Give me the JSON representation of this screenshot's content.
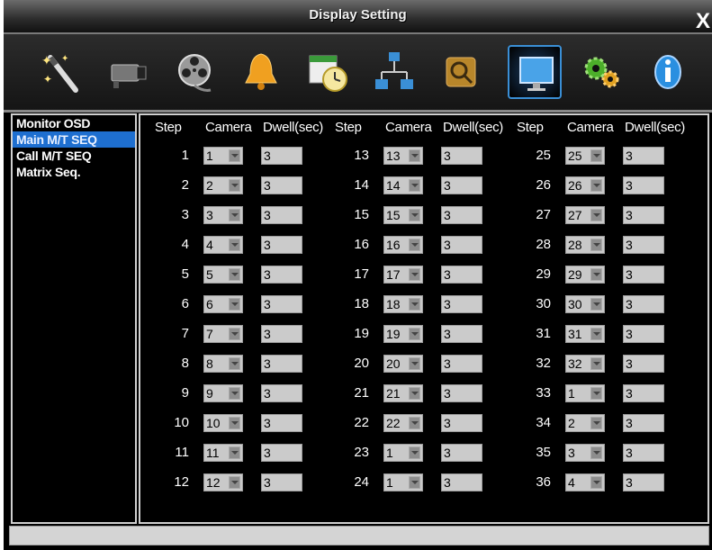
{
  "window": {
    "title": "Display Setting",
    "close_glyph": "X"
  },
  "toolbar": {
    "icons": [
      {
        "name": "wizard-wand-icon"
      },
      {
        "name": "camera-icon"
      },
      {
        "name": "film-reel-icon"
      },
      {
        "name": "alarm-bell-icon"
      },
      {
        "name": "schedule-clock-icon"
      },
      {
        "name": "network-icon"
      },
      {
        "name": "search-tools-icon"
      },
      {
        "name": "display-monitor-icon",
        "selected": true
      },
      {
        "name": "gears-icon"
      },
      {
        "name": "info-icon"
      }
    ]
  },
  "sidebar": {
    "items": [
      {
        "label": "Monitor OSD",
        "selected": false
      },
      {
        "label": "Main M/T SEQ",
        "selected": true
      },
      {
        "label": "Call M/T SEQ",
        "selected": false
      },
      {
        "label": "Matrix Seq.",
        "selected": false
      }
    ]
  },
  "table": {
    "headers": {
      "step": "Step",
      "camera": "Camera",
      "dwell": "Dwell(sec)"
    },
    "columns": [
      {
        "rows": [
          {
            "step": "1",
            "camera": "1",
            "dwell": "3"
          },
          {
            "step": "2",
            "camera": "2",
            "dwell": "3"
          },
          {
            "step": "3",
            "camera": "3",
            "dwell": "3"
          },
          {
            "step": "4",
            "camera": "4",
            "dwell": "3"
          },
          {
            "step": "5",
            "camera": "5",
            "dwell": "3"
          },
          {
            "step": "6",
            "camera": "6",
            "dwell": "3"
          },
          {
            "step": "7",
            "camera": "7",
            "dwell": "3"
          },
          {
            "step": "8",
            "camera": "8",
            "dwell": "3"
          },
          {
            "step": "9",
            "camera": "9",
            "dwell": "3"
          },
          {
            "step": "10",
            "camera": "10",
            "dwell": "3"
          },
          {
            "step": "11",
            "camera": "11",
            "dwell": "3"
          },
          {
            "step": "12",
            "camera": "12",
            "dwell": "3"
          }
        ]
      },
      {
        "rows": [
          {
            "step": "13",
            "camera": "13",
            "dwell": "3"
          },
          {
            "step": "14",
            "camera": "14",
            "dwell": "3"
          },
          {
            "step": "15",
            "camera": "15",
            "dwell": "3"
          },
          {
            "step": "16",
            "camera": "16",
            "dwell": "3"
          },
          {
            "step": "17",
            "camera": "17",
            "dwell": "3"
          },
          {
            "step": "18",
            "camera": "18",
            "dwell": "3"
          },
          {
            "step": "19",
            "camera": "19",
            "dwell": "3"
          },
          {
            "step": "20",
            "camera": "20",
            "dwell": "3"
          },
          {
            "step": "21",
            "camera": "21",
            "dwell": "3"
          },
          {
            "step": "22",
            "camera": "22",
            "dwell": "3"
          },
          {
            "step": "23",
            "camera": "1",
            "dwell": "3"
          },
          {
            "step": "24",
            "camera": "1",
            "dwell": "3"
          }
        ]
      },
      {
        "rows": [
          {
            "step": "25",
            "camera": "25",
            "dwell": "3"
          },
          {
            "step": "26",
            "camera": "26",
            "dwell": "3"
          },
          {
            "step": "27",
            "camera": "27",
            "dwell": "3"
          },
          {
            "step": "28",
            "camera": "28",
            "dwell": "3"
          },
          {
            "step": "29",
            "camera": "29",
            "dwell": "3"
          },
          {
            "step": "30",
            "camera": "30",
            "dwell": "3"
          },
          {
            "step": "31",
            "camera": "31",
            "dwell": "3"
          },
          {
            "step": "32",
            "camera": "32",
            "dwell": "3"
          },
          {
            "step": "33",
            "camera": "1",
            "dwell": "3"
          },
          {
            "step": "34",
            "camera": "2",
            "dwell": "3"
          },
          {
            "step": "35",
            "camera": "3",
            "dwell": "3"
          },
          {
            "step": "36",
            "camera": "4",
            "dwell": "3"
          }
        ]
      }
    ]
  },
  "status": {
    "text": ""
  }
}
